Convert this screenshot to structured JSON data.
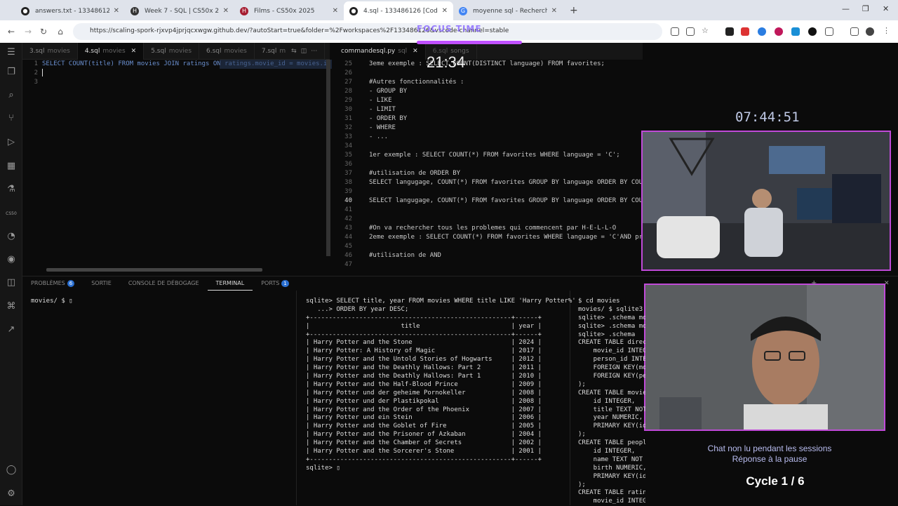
{
  "browser": {
    "tabs": [
      {
        "title": "answers.txt - 133486126 [Codes",
        "icon": "github-icon",
        "active": false
      },
      {
        "title": "Week 7 - SQL | CS50x 2025 ? | ...",
        "icon": "harvard-icon",
        "active": false
      },
      {
        "title": "Films - CS50x 2025",
        "icon": "harvard-icon",
        "active": false
      },
      {
        "title": "4.sql - 133486126 [Codespaces",
        "icon": "github-icon",
        "active": true
      },
      {
        "title": "moyenne sql - Recherche Goog",
        "icon": "google-icon",
        "active": false
      }
    ],
    "new_tab": "+",
    "url": "https://scaling-spork-rjxvp4jprjqcxwgw.github.dev/?autoStart=true&folder=%2Fworkspaces%2F133486126&vscode-channel=stable"
  },
  "overlay": {
    "focus_label": "FOCUS TIME",
    "focus_timer": "21:34",
    "clock": "07:44:51",
    "chat_note_line1": "Chat non lu pendant les sessions",
    "chat_note_line2": "Réponse à la pause",
    "cycle": "Cycle 1 / 6"
  },
  "editor": {
    "left_tabs": [
      {
        "name": "3.sql",
        "folder": "movies",
        "active": false
      },
      {
        "name": "4.sql",
        "folder": "movies",
        "active": true
      },
      {
        "name": "5.sql",
        "folder": "movies",
        "active": false
      },
      {
        "name": "6.sql",
        "folder": "movies",
        "active": false
      },
      {
        "name": "7.sql",
        "folder": "m",
        "active": false
      }
    ],
    "right_tabs": [
      {
        "name": "commandesql.py",
        "folder": "sql",
        "active": true
      },
      {
        "name": "6.sql",
        "folder": "songs",
        "active": false
      }
    ],
    "left_lines": [
      {
        "n": "1",
        "text": "SELECT COUNT(title) FROM movies JOIN ratings ON ratings.movie_id = movies.id"
      },
      {
        "n": "2",
        "text": ""
      },
      {
        "n": "3",
        "text": ""
      }
    ],
    "right_lines": [
      {
        "n": "25",
        "text": "3eme exemple : SELECT COUNT(DISTINCT language) FROM favorites;"
      },
      {
        "n": "26",
        "text": ""
      },
      {
        "n": "27",
        "text": "#Autres fonctionnalités :"
      },
      {
        "n": "28",
        "text": "- GROUP BY"
      },
      {
        "n": "29",
        "text": "- LIKE"
      },
      {
        "n": "30",
        "text": "- LIMIT"
      },
      {
        "n": "31",
        "text": "- ORDER BY"
      },
      {
        "n": "32",
        "text": "- WHERE"
      },
      {
        "n": "33",
        "text": "- ..."
      },
      {
        "n": "34",
        "text": ""
      },
      {
        "n": "35",
        "text": "1er exemple : SELECT COUNT(*) FROM favorites WHERE language = 'C';"
      },
      {
        "n": "36",
        "text": ""
      },
      {
        "n": "37",
        "text": "#utilisation de ORDER BY"
      },
      {
        "n": "38",
        "text": "SELECT langugage, COUNT(*) FROM favorites GROUP BY language ORDER BY COUNT("
      },
      {
        "n": "39",
        "text": ""
      },
      {
        "n": "40",
        "text": "SELECT langugage, COUNT(*) FROM favorites GROUP BY language ORDER BY COUNT("
      },
      {
        "n": "41",
        "text": ""
      },
      {
        "n": "42",
        "text": ""
      },
      {
        "n": "43",
        "text": "#On va rechercher tous les problemes qui commencent par H-E-L-L-O"
      },
      {
        "n": "44",
        "text": "2eme exemple : SELECT COUNT(*) FROM favorites WHERE language = 'C'AND probl"
      },
      {
        "n": "45",
        "text": ""
      },
      {
        "n": "46",
        "text": "#utilisation de AND"
      },
      {
        "n": "47",
        "text": ""
      }
    ]
  },
  "panel": {
    "tabs": [
      {
        "label": "PROBLÈMES",
        "badge": "6",
        "active": false
      },
      {
        "label": "SORTIE",
        "badge": "",
        "active": false
      },
      {
        "label": "CONSOLE DE DÉBOGAGE",
        "badge": "",
        "active": false
      },
      {
        "label": "TERMINAL",
        "badge": "",
        "active": true
      },
      {
        "label": "PORTS",
        "badge": "1",
        "active": false
      }
    ],
    "term1": [
      "movies/ $ ▯"
    ],
    "term2": [
      "sqlite> SELECT title, year FROM movies WHERE title LIKE 'Harry Potter%'",
      "   ...> ORDER BY year DESC;",
      "+-----------------------------------------------------+------+",
      "|                        title                        | year |",
      "+-----------------------------------------------------+------+",
      "| Harry Potter and the Stone                          | 2024 |",
      "| Harry Potter: A History of Magic                    | 2017 |",
      "| Harry Potter and the Untold Stories of Hogwarts     | 2012 |",
      "| Harry Potter and the Deathly Hallows: Part 2        | 2011 |",
      "| Harry Potter and the Deathly Hallows: Part 1        | 2010 |",
      "| Harry Potter and the Half-Blood Prince              | 2009 |",
      "| Harry Potter und der geheime Pornokeller            | 2008 |",
      "| Harry Potter und der Plastikpokal                   | 2008 |",
      "| Harry Potter and the Order of the Phoenix           | 2007 |",
      "| Harry Potter und ein Stein                          | 2006 |",
      "| Harry Potter and the Goblet of Fire                 | 2005 |",
      "| Harry Potter and the Prisoner of Azkaban            | 2004 |",
      "| Harry Potter and the Chamber of Secrets             | 2002 |",
      "| Harry Potter and the Sorcerer's Stone               | 2001 |",
      "+-----------------------------------------------------+------+",
      "sqlite> ▯"
    ],
    "term3": [
      "$ cd movies",
      "movies/ $ sqlite3 m",
      "sqlite> .schema mov",
      "sqlite> .schema mo",
      "sqlite> .schema",
      "CREATE TABLE direct",
      "    movie_id INTEGE",
      "    person_id INTEG",
      "    FOREIGN KEY(mov",
      "    FOREIGN KEY(per",
      ");",
      "CREATE TABLE movies",
      "    id INTEGER,",
      "    title TEXT NOT",
      "    year NUMERIC,",
      "    PRIMARY KEY(id",
      ");",
      "CREATE TABLE people (",
      "    id INTEGER,",
      "    name TEXT NOT NULL,",
      "    birth NUMERIC,",
      "    PRIMARY KEY(id)",
      ");",
      "CREATE TABLE ratings (",
      "    movie_id INTEGER NOT NULL,"
    ]
  }
}
